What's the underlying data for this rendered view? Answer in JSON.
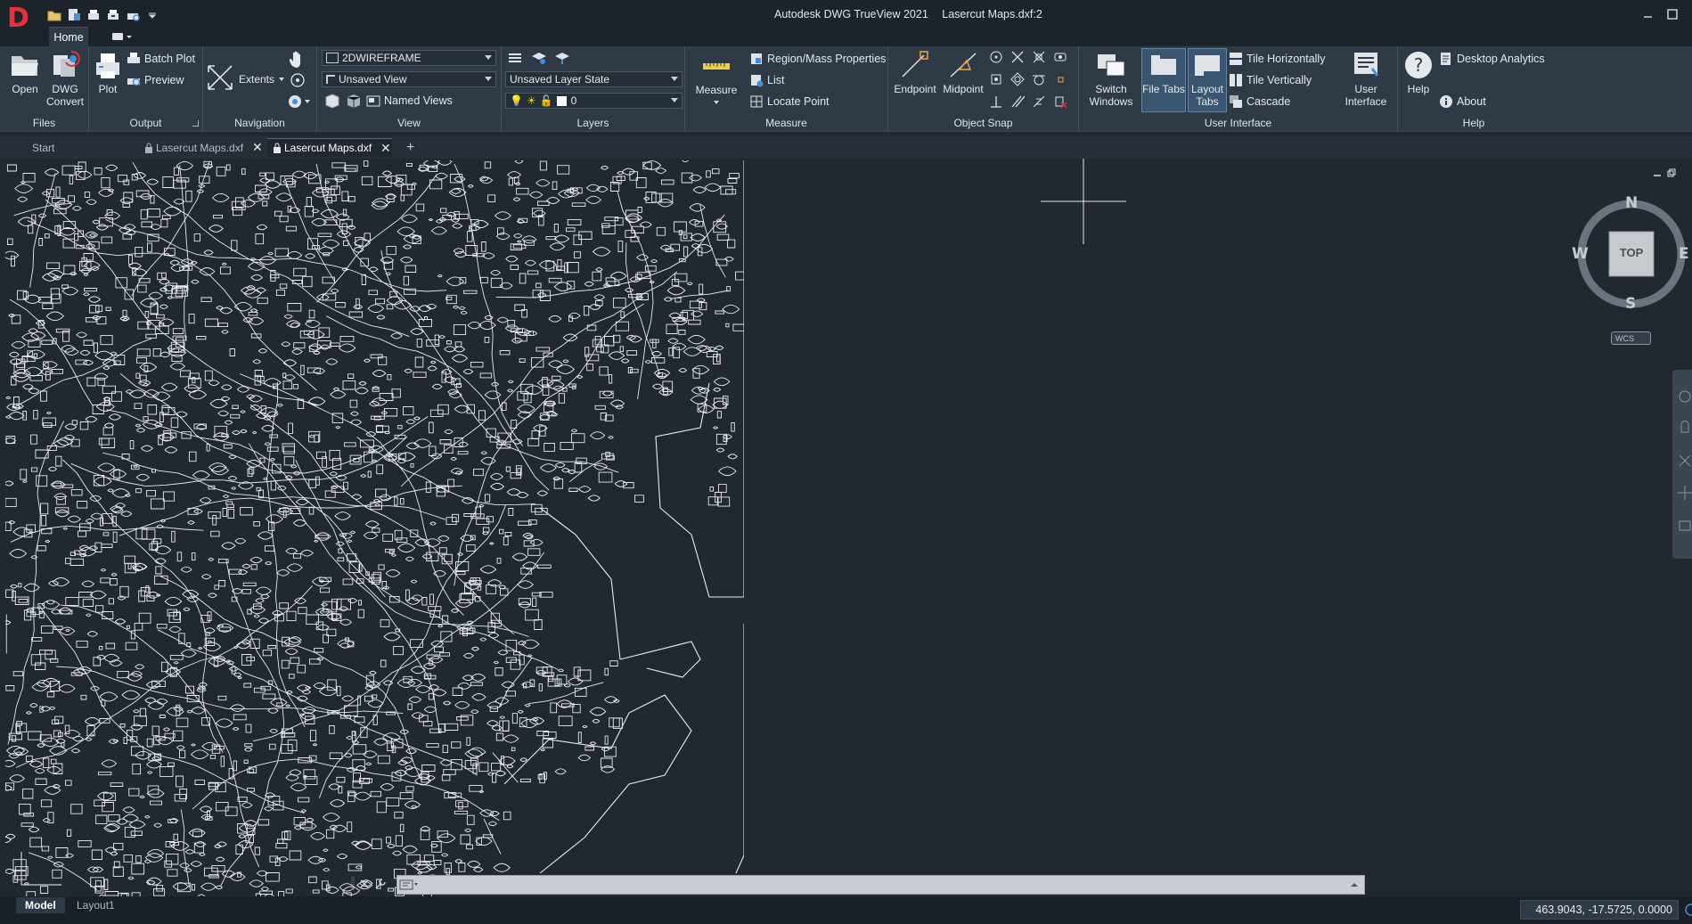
{
  "app": {
    "logo_letter": "D",
    "title": "Autodesk DWG TrueView 2021",
    "document": "Lasercut Maps.dxf:2"
  },
  "ribbon": {
    "tabs": [
      {
        "label": "Home"
      }
    ],
    "panels": {
      "files": {
        "title": "Files",
        "open": "Open",
        "dwg_convert": "DWG Convert"
      },
      "output": {
        "title": "Output",
        "plot": "Plot",
        "batch_plot": "Batch Plot",
        "preview": "Preview"
      },
      "navigation": {
        "title": "Navigation",
        "extents": "Extents"
      },
      "view": {
        "title": "View",
        "visual_style": "2DWIREFRAME",
        "saved_view": "Unsaved View",
        "named_views": "Named Views"
      },
      "layers": {
        "title": "Layers",
        "layer_state": "Unsaved Layer State",
        "current_layer": "0"
      },
      "measure": {
        "title": "Measure",
        "measure": "Measure",
        "region_mass": "Region/Mass Properties",
        "list": "List",
        "locate_point": "Locate Point"
      },
      "object_snap": {
        "title": "Object Snap",
        "endpoint": "Endpoint",
        "midpoint": "Midpoint"
      },
      "user_interface": {
        "title": "User Interface",
        "switch_windows": "Switch Windows",
        "file_tabs": "File Tabs",
        "layout_tabs": "Layout Tabs",
        "tile_horizontally": "Tile Horizontally",
        "tile_vertically": "Tile Vertically",
        "cascade": "Cascade",
        "user_interface": "User Interface"
      },
      "help": {
        "title": "Help",
        "help": "Help",
        "desktop_analytics": "Desktop Analytics",
        "about": "About"
      }
    }
  },
  "file_tabs": [
    {
      "label": "Start"
    },
    {
      "label": "Lasercut Maps.dxf"
    },
    {
      "label": "Lasercut Maps.dxf"
    }
  ],
  "viewcube": {
    "n": "N",
    "s": "S",
    "e": "E",
    "w": "W",
    "face": "TOP",
    "ucs": "WCS"
  },
  "layout_tabs": [
    {
      "label": "Model"
    },
    {
      "label": "Layout1"
    }
  ],
  "status": {
    "coordinates": "463.9043, -17.5725, 0.0000"
  },
  "colors": {
    "accent": "#5f86ad",
    "background": "#212830",
    "ribbon": "#2f3a47",
    "logo": "#e8303a"
  }
}
